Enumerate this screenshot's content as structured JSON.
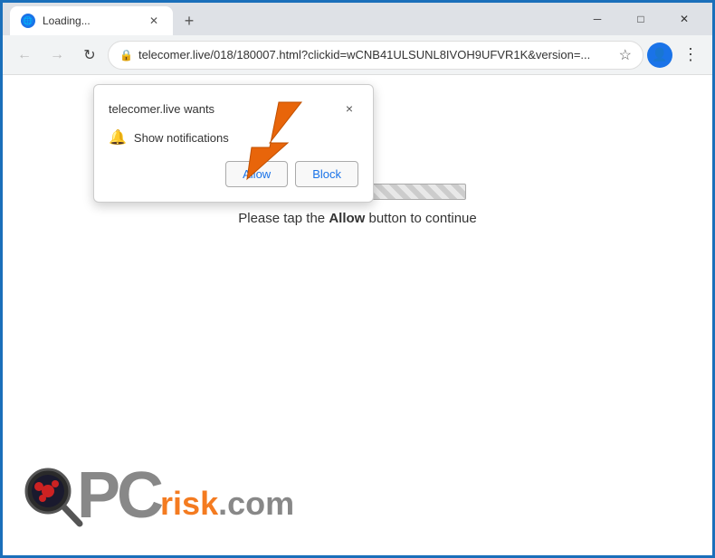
{
  "titlebar": {
    "tab": {
      "title": "Loading...",
      "favicon": "🌐"
    },
    "new_tab_label": "+",
    "window_controls": {
      "minimize": "─",
      "maximize": "□",
      "close": "✕"
    }
  },
  "navbar": {
    "back_arrow": "←",
    "forward_arrow": "→",
    "refresh": "↻",
    "address": "telecomer.live/018/180007.html?clickid=wCNB41ULSUNL8IVOH9UFVR1K&version=...",
    "lock": "🔒",
    "star": "☆",
    "menu": "⋮"
  },
  "popup": {
    "title": "telecomer.live wants",
    "notification_label": "Show notifications",
    "close_label": "×",
    "allow_label": "Allow",
    "block_label": "Block"
  },
  "page": {
    "instruction_prefix": "Please tap the ",
    "instruction_button": "Allow",
    "instruction_suffix": " button to continue"
  },
  "logo": {
    "pc": "PC",
    "risk": "risk",
    "dot_com": ".com"
  }
}
